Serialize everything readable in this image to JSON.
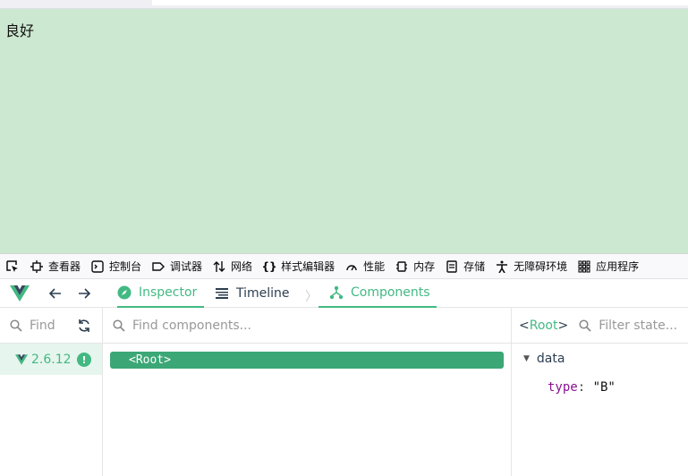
{
  "page": {
    "text": "良好"
  },
  "devtools": {
    "tabs": [
      {
        "icon": "inspector-icon",
        "label": "查看器"
      },
      {
        "icon": "console-icon",
        "label": "控制台"
      },
      {
        "icon": "debugger-icon",
        "label": "调试器"
      },
      {
        "icon": "network-icon",
        "label": "网络"
      },
      {
        "icon": "style-editor-icon",
        "label": "样式编辑器"
      },
      {
        "icon": "performance-icon",
        "label": "性能"
      },
      {
        "icon": "memory-icon",
        "label": "内存"
      },
      {
        "icon": "storage-icon",
        "label": "存储"
      },
      {
        "icon": "accessibility-icon",
        "label": "无障碍环境"
      },
      {
        "icon": "application-icon",
        "label": "应用程序"
      }
    ]
  },
  "vue": {
    "tabs": {
      "inspector": "Inspector",
      "timeline": "Timeline",
      "components": "Components"
    },
    "apps": {
      "find_placeholder": "Find",
      "version": "2.6.12",
      "warning": "!"
    },
    "tree": {
      "search_placeholder": "Find components...",
      "root_label": "<Root>"
    },
    "state": {
      "lt": "<",
      "component": "Root",
      "gt": ">",
      "filter_placeholder": "Filter state...",
      "section": "data",
      "props": [
        {
          "key": "type",
          "value": "\"B\""
        }
      ]
    }
  },
  "colors": {
    "accent": "#42b983",
    "page_bg": "#cce8d0",
    "root_bg": "#3ba776"
  }
}
